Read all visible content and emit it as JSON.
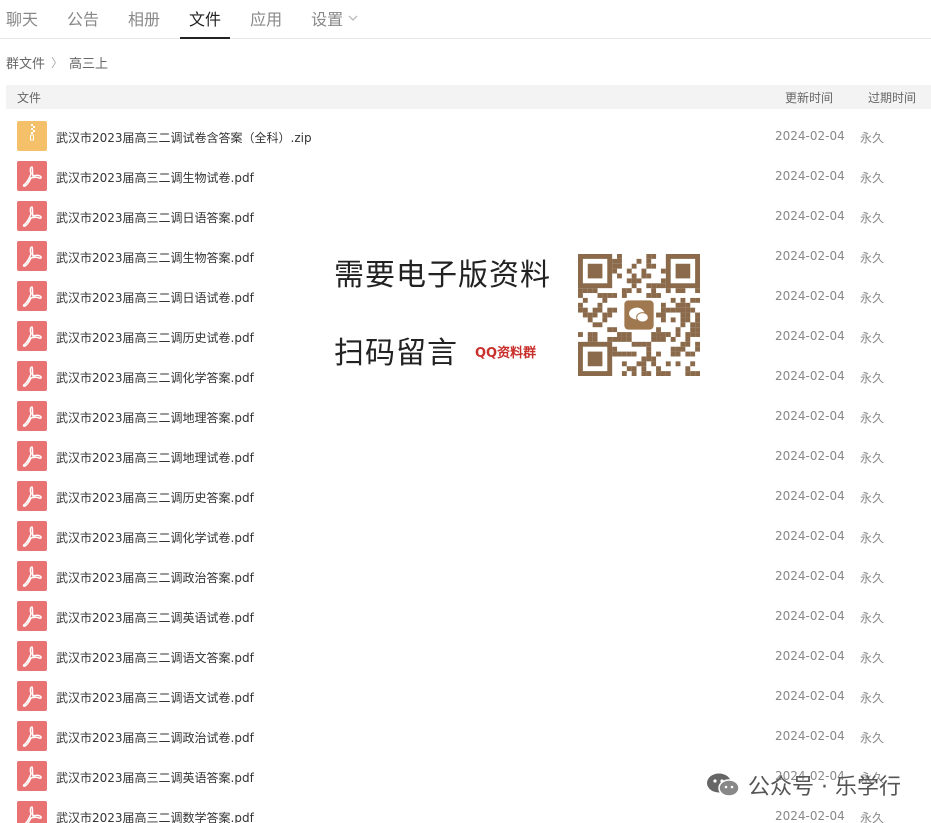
{
  "tabs": [
    {
      "label": "聊天",
      "active": false
    },
    {
      "label": "公告",
      "active": false
    },
    {
      "label": "相册",
      "active": false
    },
    {
      "label": "文件",
      "active": true
    },
    {
      "label": "应用",
      "active": false
    },
    {
      "label": "设置",
      "active": false
    }
  ],
  "breadcrumb": {
    "root": "群文件",
    "current": "高三上"
  },
  "table": {
    "headers": {
      "name": "文件",
      "updated": "更新时间",
      "expires": "过期时间"
    },
    "rows": [
      {
        "type": "zip",
        "name": "武汉市2023届高三二调试卷含答案（全科）.zip",
        "date": "2024-02-04",
        "expire": "永久"
      },
      {
        "type": "pdf",
        "name": "武汉市2023届高三二调生物试卷.pdf",
        "date": "2024-02-04",
        "expire": "永久"
      },
      {
        "type": "pdf",
        "name": "武汉市2023届高三二调日语答案.pdf",
        "date": "2024-02-04",
        "expire": "永久"
      },
      {
        "type": "pdf",
        "name": "武汉市2023届高三二调生物答案.pdf",
        "date": "2024-02-04",
        "expire": "永久"
      },
      {
        "type": "pdf",
        "name": "武汉市2023届高三二调日语试卷.pdf",
        "date": "2024-02-04",
        "expire": "永久"
      },
      {
        "type": "pdf",
        "name": "武汉市2023届高三二调历史试卷.pdf",
        "date": "2024-02-04",
        "expire": "永久"
      },
      {
        "type": "pdf",
        "name": "武汉市2023届高三二调化学答案.pdf",
        "date": "2024-02-04",
        "expire": "永久"
      },
      {
        "type": "pdf",
        "name": "武汉市2023届高三二调地理答案.pdf",
        "date": "2024-02-04",
        "expire": "永久"
      },
      {
        "type": "pdf",
        "name": "武汉市2023届高三二调地理试卷.pdf",
        "date": "2024-02-04",
        "expire": "永久"
      },
      {
        "type": "pdf",
        "name": "武汉市2023届高三二调历史答案.pdf",
        "date": "2024-02-04",
        "expire": "永久"
      },
      {
        "type": "pdf",
        "name": "武汉市2023届高三二调化学试卷.pdf",
        "date": "2024-02-04",
        "expire": "永久"
      },
      {
        "type": "pdf",
        "name": "武汉市2023届高三二调政治答案.pdf",
        "date": "2024-02-04",
        "expire": "永久"
      },
      {
        "type": "pdf",
        "name": "武汉市2023届高三二调英语试卷.pdf",
        "date": "2024-02-04",
        "expire": "永久"
      },
      {
        "type": "pdf",
        "name": "武汉市2023届高三二调语文答案.pdf",
        "date": "2024-02-04",
        "expire": "永久"
      },
      {
        "type": "pdf",
        "name": "武汉市2023届高三二调语文试卷.pdf",
        "date": "2024-02-04",
        "expire": "永久"
      },
      {
        "type": "pdf",
        "name": "武汉市2023届高三二调政治试卷.pdf",
        "date": "2024-02-04",
        "expire": "永久"
      },
      {
        "type": "pdf",
        "name": "武汉市2023届高三二调英语答案.pdf",
        "date": "2024-02-04",
        "expire": "永久"
      },
      {
        "type": "pdf",
        "name": "武汉市2023届高三二调数学答案.pdf",
        "date": "2024-02-04",
        "expire": "永久"
      }
    ]
  },
  "ad": {
    "line1": "需要电子版资料",
    "line2": "扫码留言",
    "badge": "QQ资料群"
  },
  "watermark": {
    "text": "公众号 · 乐学行"
  },
  "icons": {
    "pdf": "acrobat-pdf-icon",
    "zip": "zip-archive-icon",
    "qr": "qr-code-icon",
    "watermark": "wechat-icon"
  },
  "colors": {
    "pdf_icon_bg": "#e97272",
    "zip_icon_bg": "#f4c06a",
    "ad_badge": "#c9302c"
  }
}
